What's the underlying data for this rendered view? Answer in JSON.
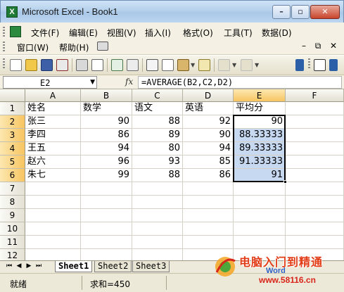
{
  "window": {
    "title": "Microsoft Excel - Book1",
    "app_icon": "X",
    "controls": {
      "minimize": "–",
      "maximize": "▫",
      "close": "✕"
    }
  },
  "menubar": {
    "items": [
      "文件(F)",
      "编辑(E)",
      "视图(V)",
      "插入(I)",
      "格式(O)",
      "工具(T)",
      "数据(D)",
      "窗口(W)",
      "帮助(H)"
    ],
    "mdi": {
      "minimize": "–",
      "restore": "⧉",
      "close": "✕"
    }
  },
  "formula_bar": {
    "name_box": "E2",
    "fx_label": "fx",
    "formula": "=AVERAGE(B2,C2,D2)"
  },
  "sheet": {
    "columns": [
      "A",
      "B",
      "C",
      "D",
      "E",
      "F"
    ],
    "rows": [
      "1",
      "2",
      "3",
      "4",
      "5",
      "6",
      "7",
      "8",
      "9",
      "10",
      "11",
      "12"
    ],
    "headers": [
      "姓名",
      "数学",
      "语文",
      "英语",
      "平均分"
    ],
    "data": [
      {
        "name": "张三",
        "math": "90",
        "chinese": "88",
        "english": "92",
        "avg": "90"
      },
      {
        "name": "李四",
        "math": "86",
        "chinese": "89",
        "english": "90",
        "avg": "88.33333"
      },
      {
        "name": "王五",
        "math": "94",
        "chinese": "80",
        "english": "94",
        "avg": "89.33333"
      },
      {
        "name": "赵六",
        "math": "96",
        "chinese": "93",
        "english": "85",
        "avg": "91.33333"
      },
      {
        "name": "朱七",
        "math": "99",
        "chinese": "88",
        "english": "86",
        "avg": "91"
      }
    ],
    "active_cell": "E2",
    "selection": "E2:E6"
  },
  "tabs": {
    "sheets": [
      "Sheet1",
      "Sheet2",
      "Sheet3"
    ],
    "active": "Sheet1",
    "nav": [
      "⏮",
      "◀",
      "▶",
      "⏭"
    ]
  },
  "status": {
    "ready": "就绪",
    "sum": "求和=450"
  },
  "watermark": {
    "title": "电脑入门到精通",
    "brand": "Word",
    "url": "www.58116.cn"
  },
  "colors": {
    "selection_fill": "#c6d9f1",
    "active_header": "#f7c561",
    "watermark_red": "#e23c17"
  }
}
